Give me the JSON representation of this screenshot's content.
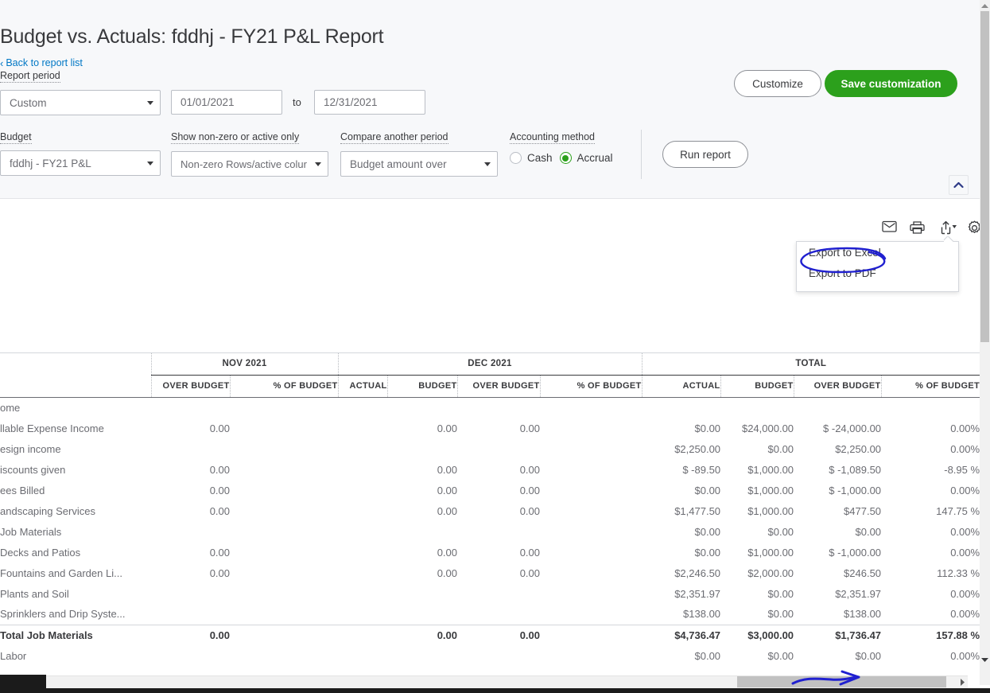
{
  "header": {
    "title": "Budget vs. Actuals: fddhj - FY21 P&L Report",
    "back_link": "Back to report list",
    "back_chevron": "‹"
  },
  "filters": {
    "report_period_label": "Report period",
    "period_value": "Custom",
    "date_from": "01/01/2021",
    "to_word": "to",
    "date_to": "12/31/2021",
    "budget_label": "Budget",
    "budget_value": "fddhj - FY21 P&L",
    "nonzero_label": "Show non-zero or active only",
    "nonzero_value": "Non-zero Rows/active colur",
    "compare_label": "Compare another period",
    "compare_value": "Budget amount over",
    "accounting_label": "Accounting method",
    "accounting_cash": "Cash",
    "accounting_accrual": "Accrual",
    "accounting_selected": "Accrual",
    "run_report": "Run report"
  },
  "actions": {
    "customize": "Customize",
    "save_customization": "Save customization",
    "accent_green": "#2ca01c",
    "link_blue": "#0077c5"
  },
  "toolbar": {
    "email_icon": "envelope-icon",
    "print_icon": "printer-icon",
    "export_icon": "export-upload-icon",
    "settings_icon": "gear-icon"
  },
  "export_menu": {
    "items": [
      {
        "label": "Export to Excel",
        "highlighted": true
      },
      {
        "label": "Export to PDF",
        "highlighted": false
      }
    ]
  },
  "annotations": {
    "ellipse_color": "#2020d0",
    "arrow_color": "#2020d0",
    "ellipse_target": "Export to Excel",
    "arrow_target": "horizontal-scrollbar"
  },
  "table": {
    "group_headers": [
      {
        "label": "",
        "span": 1
      },
      {
        "label": "NOV 2021",
        "span": 2
      },
      {
        "label": "DEC 2021",
        "span": 4
      },
      {
        "label": "TOTAL",
        "span": 4
      }
    ],
    "column_headers": [
      "",
      "OVER BUDGET",
      "% OF BUDGET",
      "ACTUAL",
      "BUDGET",
      "OVER BUDGET",
      "% OF BUDGET",
      "ACTUAL",
      "BUDGET",
      "OVER BUDGET",
      "% OF BUDGET"
    ],
    "rows": [
      {
        "label": "ome",
        "indent": 0,
        "total": false,
        "cells": [
          "",
          "",
          "",
          "",
          "",
          "",
          "",
          "",
          "",
          ""
        ]
      },
      {
        "label": "llable Expense Income",
        "indent": 0,
        "total": false,
        "cells": [
          "0.00",
          "",
          "",
          "0.00",
          "0.00",
          "",
          "$0.00",
          "$24,000.00",
          "$ -24,000.00",
          "0.00%"
        ]
      },
      {
        "label": "esign income",
        "indent": 0,
        "total": false,
        "cells": [
          "",
          "",
          "",
          "",
          "",
          "",
          "$2,250.00",
          "$0.00",
          "$2,250.00",
          "0.00%"
        ]
      },
      {
        "label": "iscounts given",
        "indent": 0,
        "total": false,
        "cells": [
          "0.00",
          "",
          "",
          "0.00",
          "0.00",
          "",
          "$ -89.50",
          "$1,000.00",
          "$ -1,089.50",
          "-8.95 %"
        ]
      },
      {
        "label": "ees Billed",
        "indent": 0,
        "total": false,
        "cells": [
          "0.00",
          "",
          "",
          "0.00",
          "0.00",
          "",
          "$0.00",
          "$1,000.00",
          "$ -1,000.00",
          "0.00%"
        ]
      },
      {
        "label": "andscaping Services",
        "indent": 0,
        "total": false,
        "cells": [
          "0.00",
          "",
          "",
          "0.00",
          "0.00",
          "",
          "$1,477.50",
          "$1,000.00",
          "$477.50",
          "147.75 %"
        ]
      },
      {
        "label": "Job Materials",
        "indent": 0,
        "total": false,
        "cells": [
          "",
          "",
          "",
          "",
          "",
          "",
          "$0.00",
          "$0.00",
          "$0.00",
          "0.00%"
        ]
      },
      {
        "label": "Decks and Patios",
        "indent": 1,
        "total": false,
        "cells": [
          "0.00",
          "",
          "",
          "0.00",
          "0.00",
          "",
          "$0.00",
          "$1,000.00",
          "$ -1,000.00",
          "0.00%"
        ]
      },
      {
        "label": "Fountains and Garden Li...",
        "indent": 1,
        "total": false,
        "cells": [
          "0.00",
          "",
          "",
          "0.00",
          "0.00",
          "",
          "$2,246.50",
          "$2,000.00",
          "$246.50",
          "112.33 %"
        ]
      },
      {
        "label": "Plants and Soil",
        "indent": 1,
        "total": false,
        "cells": [
          "",
          "",
          "",
          "",
          "",
          "",
          "$2,351.97",
          "$0.00",
          "$2,351.97",
          "0.00%"
        ]
      },
      {
        "label": "Sprinklers and Drip Syste...",
        "indent": 1,
        "total": false,
        "cells": [
          "",
          "",
          "",
          "",
          "",
          "",
          "$138.00",
          "$0.00",
          "$138.00",
          "0.00%"
        ]
      },
      {
        "label": "Total Job Materials",
        "indent": 0,
        "total": true,
        "cells": [
          "0.00",
          "",
          "",
          "0.00",
          "0.00",
          "",
          "$4,736.47",
          "$3,000.00",
          "$1,736.47",
          "157.88 %"
        ]
      },
      {
        "label": "Labor",
        "indent": 0,
        "total": false,
        "cells": [
          "",
          "",
          "",
          "",
          "",
          "",
          "$0.00",
          "$0.00",
          "$0.00",
          "0.00%"
        ]
      }
    ]
  },
  "scroll": {
    "horizontal_position": "scrolled-right",
    "vertical_position": "top"
  }
}
